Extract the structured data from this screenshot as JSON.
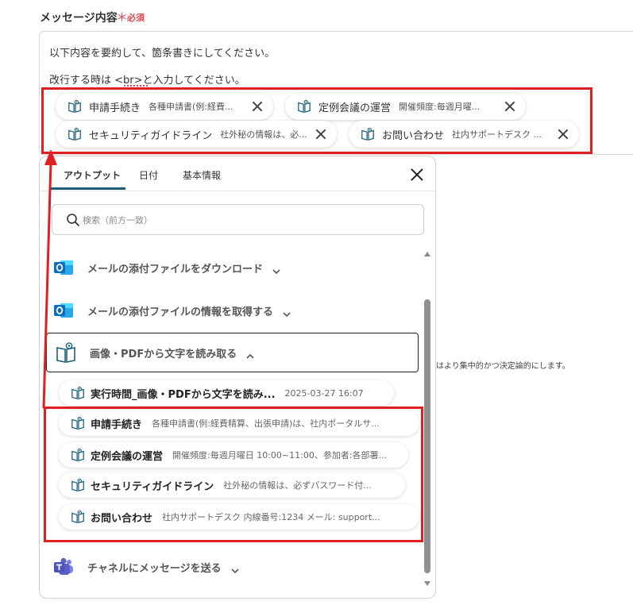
{
  "field": {
    "label": "メッセージ内容",
    "required_mark": "＊",
    "required_text": "必須"
  },
  "textarea": {
    "line1": "以下内容を要約して、箇条書きにしてください。",
    "line2": "改行する時は <br>と入力してください。"
  },
  "chips": [
    {
      "title": "申請手続き",
      "desc": "各種申請書(例:経費..."
    },
    {
      "title": "定例会議の運営",
      "desc": "開催頻度:毎週月曜..."
    },
    {
      "title": "セキュリティガイドライン",
      "desc": "社外秘の情報は、必..."
    },
    {
      "title": "お問い合わせ",
      "desc": "社内サポートデスク ..."
    }
  ],
  "panel": {
    "tabs": [
      "アウトプット",
      "日付",
      "基本情報"
    ],
    "active_tab": "アウトプット",
    "search_placeholder": "検索（前方一致）",
    "sections": [
      {
        "label": "メールの添付ファイルをダウンロード",
        "icon": "outlook-icon",
        "expanded": false
      },
      {
        "label": "メールの添付ファイルの情報を取得する",
        "icon": "outlook-icon",
        "expanded": false
      },
      {
        "label": "画像・PDFから文字を読み取る",
        "icon": "ocr-book-icon",
        "expanded": true
      },
      {
        "label": "チャネルにメッセージを送る",
        "icon": "teams-icon",
        "expanded": false
      }
    ],
    "outputs": [
      {
        "title": "実行時間_画像・PDFから文字を読み...",
        "desc": "2025-03-27 16:07"
      },
      {
        "title": "申請手続き",
        "desc": "各種申請書(例:経費精算、出張申請)は、社内ポータルサ..."
      },
      {
        "title": "定例会議の運営",
        "desc": "開催頻度:毎週月曜日 10:00~11:00、参加者:各部署..."
      },
      {
        "title": "セキュリティガイドライン",
        "desc": "社外秘の情報は、必ずパスワード付..."
      },
      {
        "title": "お問い合わせ",
        "desc": "社内サポートデスク 内線番号:1234 メール: support..."
      }
    ]
  },
  "background_note": "はより集中的かつ決定論的にします。",
  "colors": {
    "required": "#e0464f",
    "highlight": "#e02020",
    "tab_underline": "#1d5f7a",
    "outlook_blue": "#0f6cbd",
    "teams_purple": "#5b5fc7"
  }
}
